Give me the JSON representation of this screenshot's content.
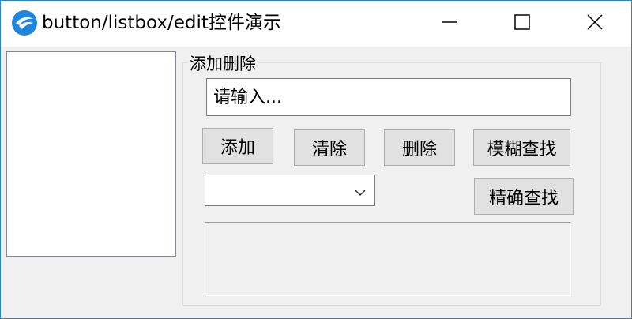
{
  "window": {
    "title": "button/listbox/edit控件演示",
    "accent_color": "#1e86dc",
    "icon": "app-logo-icon",
    "caption_icons": [
      "minimize-icon",
      "maximize-icon",
      "close-icon"
    ]
  },
  "listbox": {
    "items": []
  },
  "group": {
    "label": "添加删除",
    "edit": {
      "placeholder": "请输入...",
      "value": ""
    },
    "buttons": {
      "add": "添加",
      "clear": "清除",
      "delete": "删除",
      "fuzzy_search": "模糊查找",
      "exact_search": "精确查找"
    },
    "combo": {
      "selected": "",
      "arrow_icon": "chevron-down-icon"
    },
    "output": {
      "value": ""
    }
  }
}
